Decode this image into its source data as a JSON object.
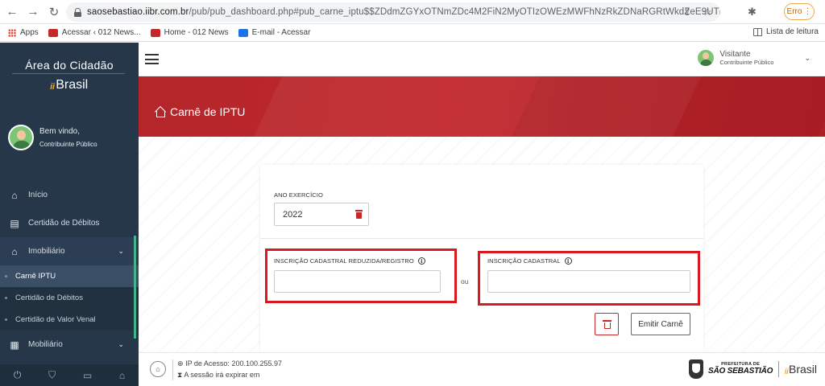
{
  "browser": {
    "url_domain": "saosebastiao.iibr.com.br",
    "url_path": "/pub/pub_dashboard.php#pub_carne_iptu$$ZDdmZGYxOTNmZDc4M2FiN2MyOTIzOWEzMWFhNzRkZDNaRGRtWkdZeE9UTm1aRGM0TTJG...",
    "error_label": "Erro",
    "bookmarks": [
      "Apps",
      "Acessar ‹ 012 News...",
      "Home - 012 News",
      "E-mail - Acessar"
    ],
    "reading_list": "Lista de leitura"
  },
  "sidebar": {
    "title": "Área do Cidadão",
    "logo_text": "Brasil",
    "welcome": "Bem vindo,",
    "role": "Contribuinte Público",
    "menu": [
      {
        "label": "Início",
        "icon": "home-icon"
      },
      {
        "label": "Certidão de Débitos",
        "icon": "document-icon"
      },
      {
        "label": "Imobiliário",
        "icon": "home-icon"
      }
    ],
    "submenu": [
      "Carnê IPTU",
      "Certidão de Débitos",
      "Certidão de Valor Venal"
    ],
    "menu_after": {
      "label": "Mobiliário",
      "icon": "building-icon"
    }
  },
  "header": {
    "visitor_name": "Visitante",
    "visitor_role": "Contribuinte Público"
  },
  "page": {
    "title": "Carnê de IPTU"
  },
  "form": {
    "year_label": "ANO EXERCÍCIO",
    "year_value": "2022",
    "reduced_label": "INSCRIÇÃO CADASTRAL REDUZIDA/REGISTRO",
    "reduced_value": "",
    "or_text": "ou",
    "cadastral_label": "INSCRIÇÃO CADASTRAL",
    "cadastral_value": "",
    "emit_label": "Emitir Carnê"
  },
  "footer": {
    "ip_text": "IP de Acesso: 200.100.255.97",
    "session_text": "A sessão irá expirar em",
    "pref_small": "PREFEITURA DE",
    "pref_big": "SÃO SEBASTIÃO",
    "logo_text": "Brasil"
  },
  "colors": {
    "sidebar_bg": "#26374a",
    "hero_red": "#c1272d",
    "accent_orange": "#f6a928",
    "highlight_red": "#d71920",
    "active_green": "#45b38a"
  }
}
